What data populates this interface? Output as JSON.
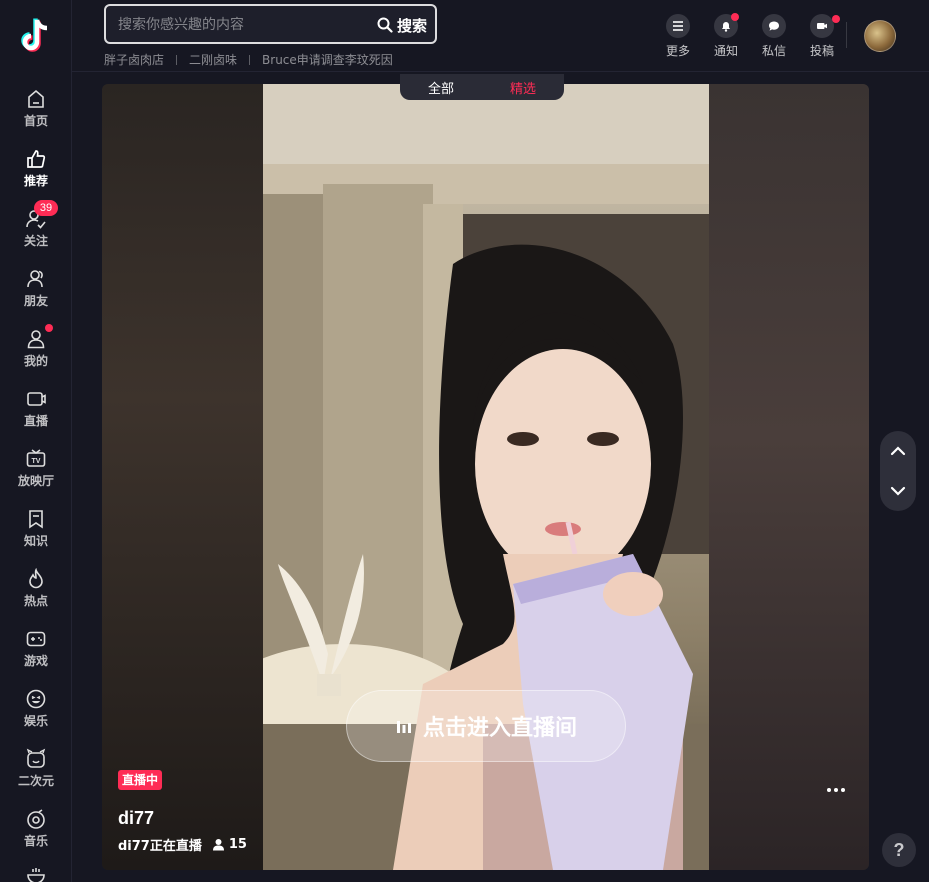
{
  "sidebar": {
    "items": [
      {
        "label": "首页",
        "icon": "home-icon"
      },
      {
        "label": "推荐",
        "icon": "thumbs-up-icon",
        "active": true
      },
      {
        "label": "关注",
        "icon": "follow-icon",
        "badge": "39"
      },
      {
        "label": "朋友",
        "icon": "friends-icon"
      },
      {
        "label": "我的",
        "icon": "profile-icon",
        "dot": true
      },
      {
        "label": "直播",
        "icon": "live-icon"
      },
      {
        "label": "放映厅",
        "icon": "tv-icon"
      },
      {
        "label": "知识",
        "icon": "bookmark-icon"
      },
      {
        "label": "热点",
        "icon": "flame-icon"
      },
      {
        "label": "游戏",
        "icon": "gamepad-icon"
      },
      {
        "label": "娱乐",
        "icon": "smile-icon"
      },
      {
        "label": "二次元",
        "icon": "anime-icon"
      },
      {
        "label": "音乐",
        "icon": "music-icon"
      }
    ]
  },
  "search": {
    "placeholder": "搜索你感兴趣的内容",
    "button_label": "搜索",
    "hot_words": [
      "胖子卤肉店",
      "二刚卤味",
      "Bruce申请调查李玟死因"
    ]
  },
  "header_actions": [
    {
      "label": "更多",
      "icon": "menu-icon",
      "dot": false
    },
    {
      "label": "通知",
      "icon": "bell-icon",
      "dot": true
    },
    {
      "label": "私信",
      "icon": "message-icon",
      "dot": false
    },
    {
      "label": "投稿",
      "icon": "upload-icon",
      "dot": true
    }
  ],
  "feed_tabs": {
    "all": "全部",
    "featured": "精选"
  },
  "live": {
    "enter_label": "点击进入直播间",
    "badge": "直播中",
    "streamer": "di77",
    "status": "di77正在直播",
    "viewers": "15"
  },
  "help_label": "?",
  "colors": {
    "accent": "#fe2c55",
    "background": "#161722"
  }
}
